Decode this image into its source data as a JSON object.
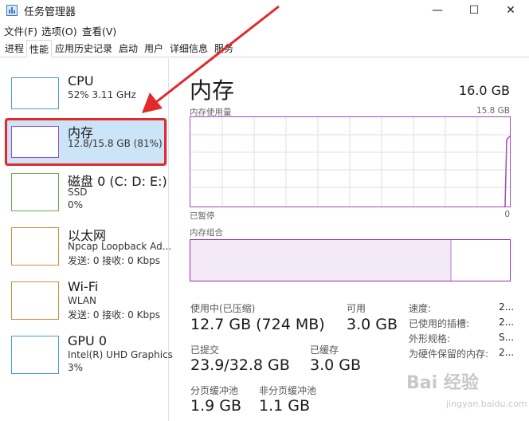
{
  "window": {
    "title": "任务管理器",
    "minimize": "—",
    "maximize": "☐",
    "close": "✕"
  },
  "menu": {
    "file": "文件(F)",
    "options": "选项(O)",
    "view": "查看(V)"
  },
  "tabs": [
    "进程",
    "性能",
    "应用历史记录",
    "启动",
    "用户",
    "详细信息",
    "服务"
  ],
  "sidebar": {
    "cpu": {
      "name": "CPU",
      "line1": "52%  3.11 GHz"
    },
    "memory": {
      "name": "内存",
      "line1": "12.8/15.8 GB (81%)"
    },
    "disk": {
      "name": "磁盘 0 (C: D: E:)",
      "line1": "SSD",
      "line2": "0%"
    },
    "ethernet": {
      "name": "以太网",
      "line1": "Npcap Loopback Ad...",
      "line2": "发送: 0  接收: 0 Kbps"
    },
    "wifi": {
      "name": "Wi-Fi",
      "line1": "WLAN",
      "line2": "发送: 0  接收: 0 Kbps"
    },
    "gpu": {
      "name": "GPU 0",
      "line1": "Intel(R) UHD Graphics",
      "line2": "3%"
    }
  },
  "main": {
    "title": "内存",
    "total": "16.0 GB",
    "usage_label": "内存使用量",
    "usage_max": "15.8 GB",
    "time_label": "已暂停",
    "zero": "0",
    "composition_label": "内存组合",
    "stats": {
      "in_use_label": "使用中(已压缩)",
      "in_use_value": "12.7 GB (724 MB)",
      "available_label": "可用",
      "available_value": "3.0 GB",
      "committed_label": "已提交",
      "committed_value": "23.9/32.8 GB",
      "cached_label": "已缓存",
      "cached_value": "3.0 GB",
      "paged_label": "分页缓冲池",
      "paged_value": "1.9 GB",
      "nonpaged_label": "非分页缓冲池",
      "nonpaged_value": "1.1 GB"
    },
    "right_stats": {
      "speed_label": "速度:",
      "speed_value": "2...",
      "slots_label": "已使用的插槽:",
      "slots_value": "2...",
      "form_label": "外形规格:",
      "form_value": "S...",
      "reserved_label": "为硬件保留的内存:",
      "reserved_value": "2..."
    }
  },
  "watermark": {
    "text": "Bai 经验",
    "sub": "jingyan.baidu.com"
  },
  "colors": {
    "memory": "#a24ac0",
    "cpu": "#4b9bd6",
    "disk": "#6aa84f",
    "ethernet": "#c8903a",
    "wifi": "#c8903a",
    "gpu": "#4b9bd6",
    "selected": "#cce4f7",
    "annotation": "#e22a2a"
  }
}
